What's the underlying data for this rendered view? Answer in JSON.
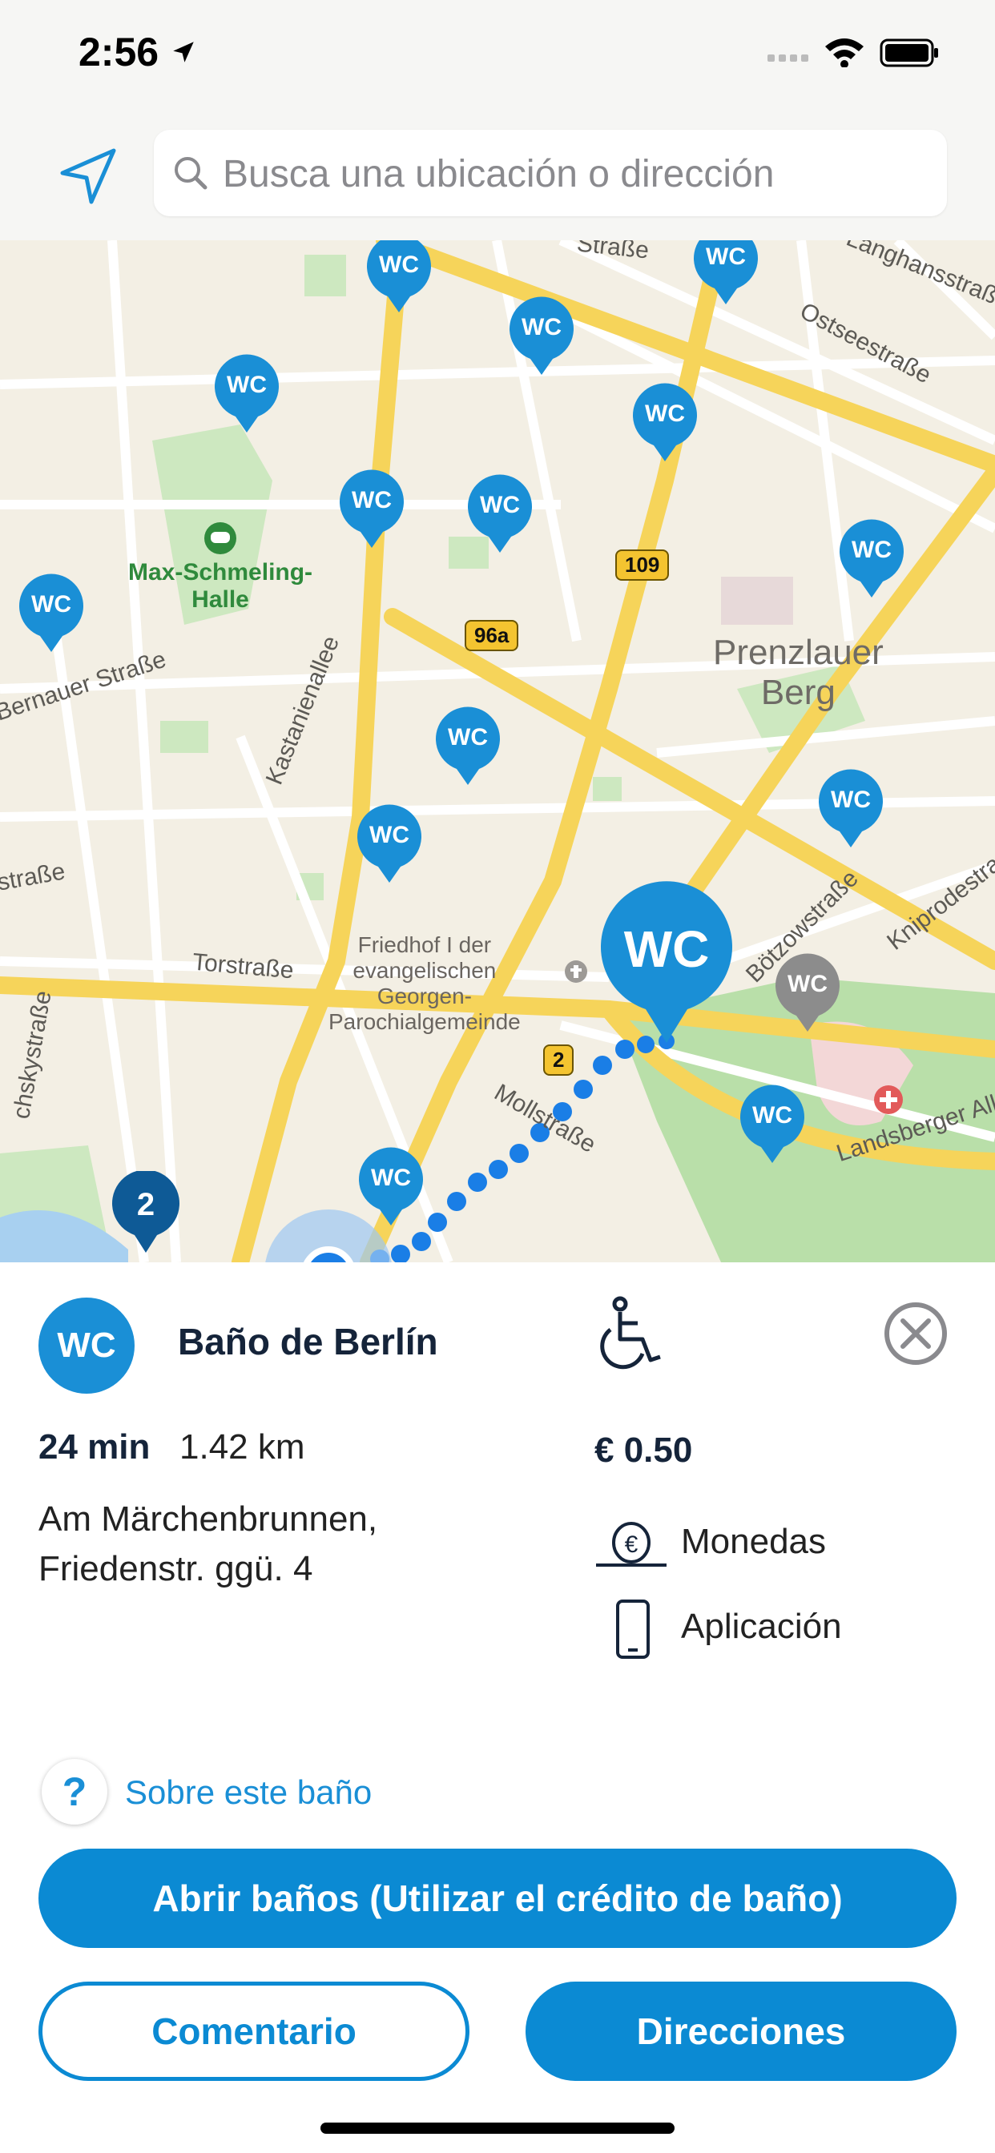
{
  "status_bar": {
    "time": "2:56"
  },
  "search": {
    "placeholder": "Busca una ubicación o dirección"
  },
  "map": {
    "street_labels": [
      "Ostseestraße",
      "Langhansstraße",
      "Bernauer Straße",
      "Kastanienallee",
      "Torstraße",
      "Mollstraße",
      "Bötzowstraße",
      "Kniprodestraße",
      "Landsberger Alle",
      "Straße",
      "nstraße",
      "chskystraße",
      "Straße"
    ],
    "place_labels": {
      "park": "Max-Schmeling-\nHalle",
      "district": "Prenzlauer\nBerg",
      "cemetery": "Friedhof I der\nevangelischen\nGeorgen-\nParochialgemeinde"
    },
    "road_shields": [
      "109",
      "96a",
      "2"
    ],
    "pin_label": "WC",
    "cluster_count": "2"
  },
  "detail": {
    "badge": "WC",
    "name": "Baño de Berlín",
    "duration": "24 min",
    "distance": "1.42 km",
    "address_line1": "Am Märchenbrunnen,",
    "address_line2": "Friedenstr. ggü. 4",
    "price": "€ 0.50",
    "payment": [
      "Monedas",
      "Aplicación"
    ],
    "about_icon": "?",
    "about_link": "Sobre este baño"
  },
  "buttons": {
    "open": "Abrir baños (Utilizar el crédito de baño)",
    "comment": "Comentario",
    "directions": "Direcciones"
  },
  "colors": {
    "accent": "#0b8ad3",
    "pin": "#1a8fd6",
    "map_bg": "#f3efe4",
    "road": "#f6d45a"
  }
}
